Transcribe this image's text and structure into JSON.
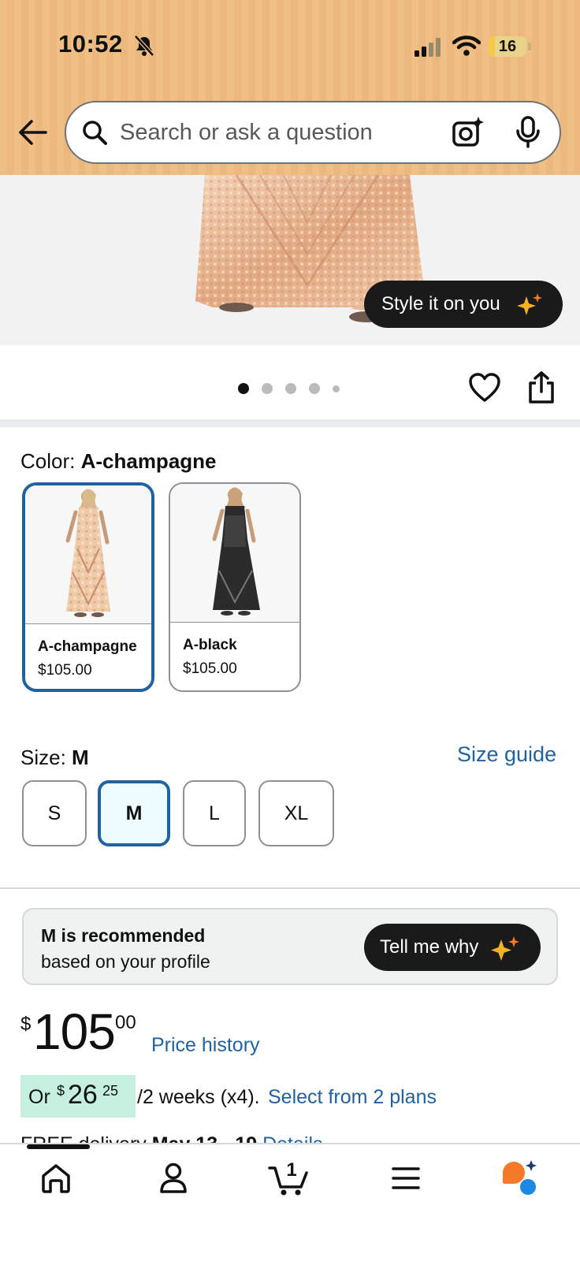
{
  "status_bar": {
    "time": "10:52",
    "battery_level": "16",
    "battery_fraction": 0.16
  },
  "search": {
    "placeholder": "Search or ask a question"
  },
  "product_image": {
    "style_button_label": "Style it on you",
    "carousel_pages": 5,
    "carousel_active_index": 0
  },
  "color": {
    "label": "Color: ",
    "selected": "A-champagne",
    "options": [
      {
        "name": "A-champagne",
        "price": "$105.00",
        "selected": true
      },
      {
        "name": "A-black",
        "price": "$105.00",
        "selected": false
      }
    ]
  },
  "size": {
    "label": "Size: ",
    "selected": "M",
    "guide_link": "Size guide",
    "options": [
      "S",
      "M",
      "L",
      "XL"
    ]
  },
  "recommendation": {
    "title": "M is recommended",
    "subtitle": "based on your profile",
    "button_label": "Tell me why"
  },
  "price": {
    "symbol": "$",
    "whole": "105",
    "fraction": "00",
    "history_link": "Price history"
  },
  "installment": {
    "prefix": "Or",
    "symbol": "$",
    "whole": "26",
    "fraction": "25",
    "suffix": "/2 weeks (x4).",
    "link": "Select from 2 plans"
  },
  "delivery": {
    "prefix": "FREE delivery ",
    "dates": "May 13 - 19",
    "link": "Details"
  },
  "bottom_nav": {
    "cart_count": "1"
  },
  "colors": {
    "header_bg": "#f0bf86",
    "link": "#2162a1",
    "selected_border": "#2162a1",
    "install_highlight": "#c5f0e0",
    "dark_pill": "#1a1a1a"
  }
}
